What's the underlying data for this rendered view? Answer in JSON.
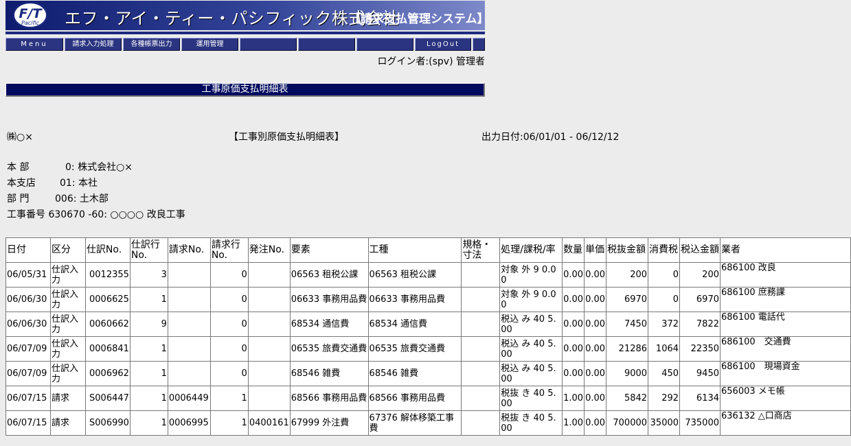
{
  "banner": {
    "logo_text": "F/T",
    "logo_sub": "Pacific",
    "company": "エフ・アイ・ティー・パシフィック株式会社",
    "system": "【請求支払管理システム】"
  },
  "nav": [
    "Menu",
    "請求入力処理",
    "各種帳票出力",
    "運用管理",
    "",
    "",
    "",
    "LogOut",
    ""
  ],
  "login": "ログイン者:(spv) 管理者",
  "page_title": "工事原価支払明細表",
  "report": {
    "company": "㈱○×",
    "title": "【工事別原価支払明細表】",
    "period": "出力日付:06/01/01 - 06/12/12"
  },
  "info": [
    {
      "label": "本 部",
      "value": "0: 株式会社○×"
    },
    {
      "label": "本支店",
      "value": "01: 本社"
    },
    {
      "label": "部 門",
      "value": "006: 土木部"
    },
    {
      "label": "工事番号",
      "value": "630670 -60: ○○○○ 改良工事"
    }
  ],
  "columns": [
    "日付",
    "区分",
    "仕訳No.",
    "仕訳行No.",
    "請求No.",
    "請求行No.",
    "発注No.",
    "要素",
    "工種",
    "規格・寸法",
    "処理/課税/率",
    "数量",
    "単価",
    "税抜金額",
    "消費税",
    "税込金額",
    "業者"
  ],
  "rows": [
    [
      "06/05/31",
      "仕訳入力",
      "0012355",
      "3",
      "",
      "0",
      "",
      "06563 租税公課",
      "06563 租税公課",
      "",
      "対象 外 9 0.00",
      "0.00",
      "0.00",
      "200",
      "0",
      "200",
      "686100 改良"
    ],
    [
      "06/06/30",
      "仕訳入力",
      "0006625",
      "1",
      "",
      "0",
      "",
      "06633 事務用品費",
      "06633 事務用品費",
      "",
      "対象 外 9 0.00",
      "0.00",
      "0.00",
      "6970",
      "0",
      "6970",
      "686100 庶務課"
    ],
    [
      "06/06/30",
      "仕訳入力",
      "0060662",
      "9",
      "",
      "0",
      "",
      "68534 通信費",
      "68534 通信費",
      "",
      "税込 み 40 5.00",
      "0.00",
      "0.00",
      "7450",
      "372",
      "7822",
      "686100 電話代"
    ],
    [
      "06/07/09",
      "仕訳入力",
      "0006841",
      "1",
      "",
      "0",
      "",
      "06535 旅費交通費",
      "06535 旅費交通費",
      "",
      "税込 み 40 5.00",
      "0.00",
      "0.00",
      "21286",
      "1064",
      "22350",
      "686100　交通費"
    ],
    [
      "06/07/09",
      "仕訳入力",
      "0006962",
      "1",
      "",
      "0",
      "",
      "68546 雑費",
      "68546 雑費",
      "",
      "税込 み 40 5.00",
      "0.00",
      "0.00",
      "9000",
      "450",
      "9450",
      "686100　現場資金"
    ],
    [
      "06/07/15",
      "請求",
      "S006447",
      "1",
      "0006449",
      "1",
      "",
      "68566 事務用品費",
      "68566 事務用品費",
      "",
      "税抜 き 40 5.00",
      "1.00",
      "0.00",
      "5842",
      "292",
      "6134",
      "656003 メモ帳"
    ],
    [
      "06/07/15",
      "請求",
      "S006990",
      "1",
      "0006995",
      "1",
      "0400161",
      "67999 外注費",
      "67376 解体移築工事費",
      "",
      "税抜 き 40 5.00",
      "1.00",
      "0.00",
      "700000",
      "35000",
      "735000",
      "636132 △口商店"
    ]
  ]
}
